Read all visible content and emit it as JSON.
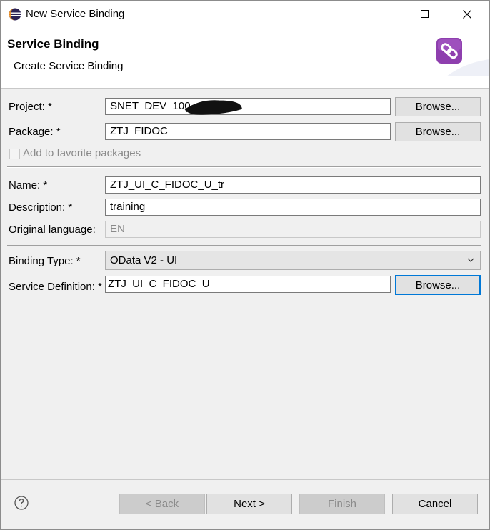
{
  "window": {
    "title": "New Service Binding"
  },
  "header": {
    "title": "Service Binding",
    "subtitle": "Create Service Binding"
  },
  "form": {
    "project": {
      "label": "Project: *",
      "value": "SNET_DEV_100_",
      "button": "Browse..."
    },
    "package": {
      "label": "Package: *",
      "value": "ZTJ_FIDOC",
      "button": "Browse..."
    },
    "favorite": {
      "label": "Add to favorite packages",
      "checked": false
    },
    "name": {
      "label": "Name: *",
      "value": "ZTJ_UI_C_FIDOC_U_tr"
    },
    "description": {
      "label": "Description: *",
      "value": "training"
    },
    "original_language": {
      "label": "Original language:",
      "value": "EN"
    },
    "binding_type": {
      "label": "Binding Type: *",
      "value": "OData V2 - UI"
    },
    "service_definition": {
      "label": "Service Definition: *",
      "value": "ZTJ_UI_C_FIDOC_U",
      "button": "Browse..."
    }
  },
  "footer": {
    "back": "< Back",
    "next": "Next >",
    "finish": "Finish",
    "cancel": "Cancel"
  },
  "colors": {
    "focus": "#0078d7",
    "icon_purple": "#8e3fae",
    "disabled_text": "#8a8a8a"
  }
}
